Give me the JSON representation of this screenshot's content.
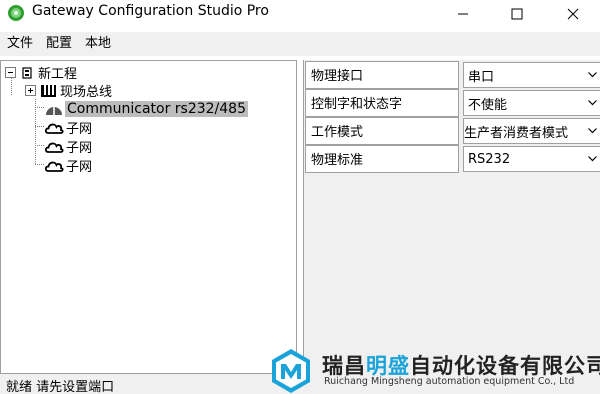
{
  "window": {
    "title": "Gateway Configuration Studio Pro"
  },
  "menu": [
    "文件",
    "配置",
    "本地"
  ],
  "tree": {
    "root": "新工程",
    "fieldbus": "现场总线",
    "communicator": "Communicator rs232/485",
    "subnets": [
      "子网",
      "子网",
      "子网"
    ]
  },
  "properties": [
    {
      "name": "物理接口",
      "value": "串口"
    },
    {
      "name": "控制字和状态字",
      "value": "不使能"
    },
    {
      "name": "工作模式",
      "value": "生产者消费者模式"
    },
    {
      "name": "物理标准",
      "value": "RS232"
    }
  ],
  "status": {
    "text": "就绪  请先设置端口"
  },
  "watermark": {
    "cn_prefix": "瑞昌",
    "cn_highlight": "明盛",
    "cn_suffix": "自动化设备有限公司",
    "en": "Ruichang Mingsheng automation equipment Co., Ltd"
  },
  "colors": {
    "selection": "#bcbcbc",
    "panel_bg": "#f0f0f0",
    "brand": "#1aa3d9"
  },
  "icons": {
    "app": "gateway-app-icon",
    "root": "project-icon",
    "fieldbus": "bus-icon",
    "communicator": "gateway-device-icon",
    "subnet": "cloud-icon"
  }
}
